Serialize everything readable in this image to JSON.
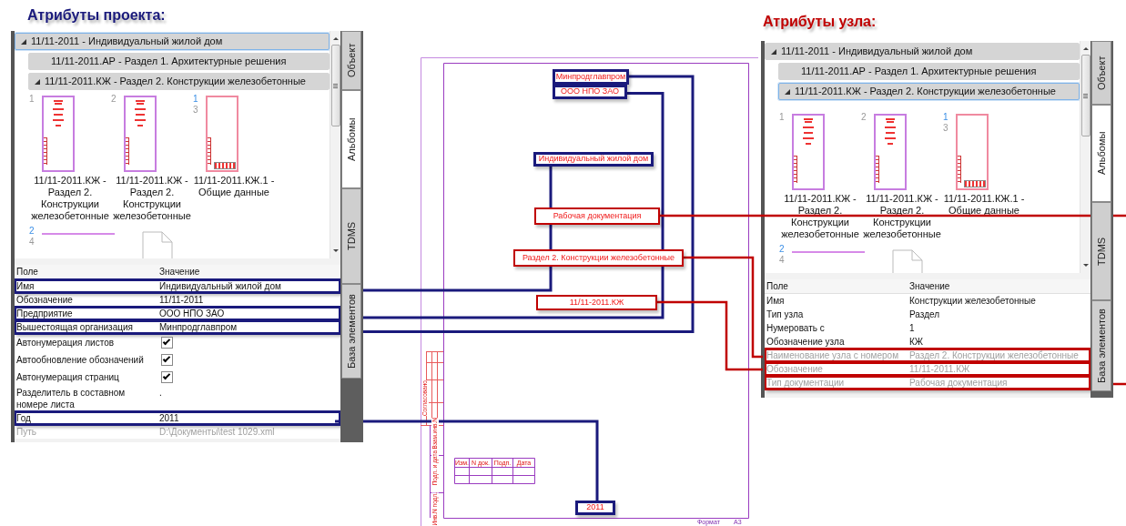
{
  "panels": [
    {
      "title": "Атрибуты проекта:",
      "color": "#1a1a7c",
      "tree": [
        {
          "label": "11/11-2011 - Индивидуальный жилой дом",
          "expanded": true,
          "selected": true,
          "children": [
            {
              "label": "11/11-2011.АР - Раздел 1. Архитектурные решения",
              "selected": false
            },
            {
              "label": "11/11-2011.КЖ - Раздел 2. Конструкции железобетонные",
              "expanded": true,
              "selected": false
            }
          ]
        }
      ],
      "sheets": [
        {
          "kind": "title",
          "numbers": [
            {
              "text": "1",
              "kind": "sheet"
            }
          ],
          "caption": "11/11-2011.КЖ - Раздел 2. Конструкции железобетонные"
        },
        {
          "kind": "title",
          "numbers": [
            {
              "text": "2",
              "kind": "sheet"
            }
          ],
          "caption": "11/11-2011.КЖ - Раздел 2. Конструкции железобетонные"
        },
        {
          "kind": "general",
          "numbers": [
            {
              "text": "1",
              "kind": "page"
            },
            {
              "text": "3",
              "kind": "sheet"
            }
          ],
          "caption": "11/11-2011.КЖ.1 - Общие данные"
        },
        {
          "kind": "partial",
          "numbers": [
            {
              "text": "2",
              "kind": "page"
            },
            {
              "text": "4",
              "kind": "sheet"
            }
          ]
        },
        {
          "kind": "blank"
        }
      ],
      "tabs": [
        {
          "label": "Объект",
          "selected": false
        },
        {
          "label": "Альбомы",
          "selected": true
        },
        {
          "label": "TDMS",
          "selected": false
        },
        {
          "label": "База элементов",
          "selected": false
        }
      ],
      "columns": [
        "Поле",
        "Значение"
      ],
      "rows": [
        {
          "kind": "text",
          "field": "Имя",
          "value": "Индивидуальный жилой дом",
          "highlighted": true,
          "disabled": false
        },
        {
          "kind": "text",
          "field": "Обозначение",
          "value": "11/11-2011",
          "highlighted": false,
          "disabled": false
        },
        {
          "kind": "text",
          "field": "Предприятие",
          "value": "ООО НПО ЗАО",
          "highlighted": true,
          "disabled": false
        },
        {
          "kind": "text",
          "field": "Вышестоящая организация",
          "value": "Минпродглавпром",
          "highlighted": true,
          "disabled": false
        },
        {
          "kind": "checkbox",
          "field": "Автонумерация листов",
          "checked": true,
          "highlighted": false,
          "disabled": false
        },
        {
          "kind": "checkbox",
          "field": "Автообновление обозначений",
          "checked": true,
          "highlighted": false,
          "disabled": false
        },
        {
          "kind": "checkbox",
          "field": "Автонумерация страниц",
          "checked": true,
          "highlighted": false,
          "disabled": false
        },
        {
          "kind": "text",
          "field": "Разделитель в составном номере листа",
          "value": ".",
          "highlighted": false,
          "disabled": false
        },
        {
          "kind": "text",
          "field": "Год",
          "value": "2011",
          "highlighted": true,
          "disabled": false
        },
        {
          "kind": "text",
          "field": "Путь",
          "value": "D:\\Документы\\test 1029.xml",
          "highlighted": false,
          "disabled": true
        }
      ]
    },
    {
      "title": "Атрибуты узла:",
      "color": "#c00000",
      "tree": [
        {
          "label": "11/11-2011 - Индивидуальный жилой дом",
          "expanded": true,
          "selected": false,
          "children": [
            {
              "label": "11/11-2011.АР - Раздел 1. Архитектурные решения",
              "selected": false
            },
            {
              "label": "11/11-2011.КЖ - Раздел 2. Конструкции железобетонные",
              "expanded": true,
              "selected": true
            }
          ]
        }
      ],
      "sheets": [
        {
          "kind": "title",
          "numbers": [
            {
              "text": "1",
              "kind": "sheet"
            }
          ],
          "caption": "11/11-2011.КЖ - Раздел 2. Конструкции железобетонные"
        },
        {
          "kind": "title",
          "numbers": [
            {
              "text": "2",
              "kind": "sheet"
            }
          ],
          "caption": "11/11-2011.КЖ - Раздел 2. Конструкции железобетонные"
        },
        {
          "kind": "general",
          "numbers": [
            {
              "text": "1",
              "kind": "page"
            },
            {
              "text": "3",
              "kind": "sheet"
            }
          ],
          "caption": "11/11-2011.КЖ.1 - Общие данные"
        },
        {
          "kind": "partial",
          "numbers": [
            {
              "text": "2",
              "kind": "page"
            },
            {
              "text": "4",
              "kind": "sheet"
            }
          ]
        },
        {
          "kind": "blank"
        }
      ],
      "tabs": [
        {
          "label": "Объект",
          "selected": false
        },
        {
          "label": "Альбомы",
          "selected": true
        },
        {
          "label": "TDMS",
          "selected": false
        },
        {
          "label": "База элементов",
          "selected": false
        }
      ],
      "columns": [
        "Поле",
        "Значение"
      ],
      "rows": [
        {
          "kind": "text",
          "field": "Имя",
          "value": "Конструкции железобетонные",
          "highlighted": false,
          "disabled": false
        },
        {
          "kind": "text",
          "field": "Тип узла",
          "value": "Раздел",
          "highlighted": false,
          "disabled": false
        },
        {
          "kind": "text",
          "field": "Нумеровать с",
          "value": "1",
          "highlighted": false,
          "disabled": false
        },
        {
          "kind": "text",
          "field": "Обозначение узла",
          "value": "КЖ",
          "highlighted": false,
          "disabled": false
        },
        {
          "kind": "text",
          "field": "Наименование узла с номером",
          "value": "Раздел 2. Конструкции железобетонные",
          "highlighted": true,
          "disabled": true
        },
        {
          "kind": "text",
          "field": "Обозначение",
          "value": "11/11-2011.КЖ",
          "highlighted": true,
          "disabled": true
        },
        {
          "kind": "text",
          "field": "Тип документации",
          "value": "Рабочая документация",
          "highlighted": true,
          "disabled": true
        }
      ]
    }
  ],
  "drawing": {
    "labels": [
      {
        "text": "Минпродглавпром",
        "color": "#1a1a7c"
      },
      {
        "text": "ООО НПО ЗАО",
        "color": "#1a1a7c"
      },
      {
        "text": "Индивидуальный жилой дом",
        "color": "#1a1a7c"
      },
      {
        "text": "Рабочая документация",
        "color": "#c00000"
      },
      {
        "text": "Раздел 2. Конструкции железобетонные",
        "color": "#c00000"
      },
      {
        "text": "11/11-2011.КЖ",
        "color": "#c00000"
      },
      {
        "text": "2011",
        "color": "#1a1a7c"
      }
    ],
    "margin_labels": [
      "Согласовано",
      "Взам.инв.N",
      "Подп. и дата",
      "Инв.N подл."
    ],
    "table_headers": [
      "Изм.",
      "N док.",
      "Подп.",
      "Дата"
    ],
    "format_label": "Формат",
    "format_value": "А3"
  }
}
